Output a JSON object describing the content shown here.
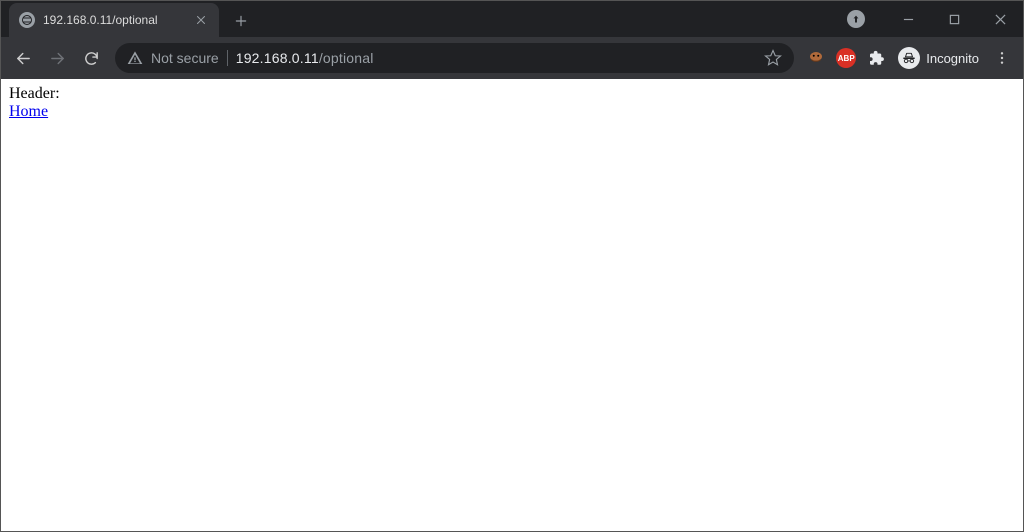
{
  "tab": {
    "title": "192.168.0.11/optional"
  },
  "toolbar": {
    "not_secure_label": "Not secure",
    "url_host": "192.168.0.11",
    "url_path": "/optional",
    "incognito_label": "Incognito",
    "abp_label": "ABP"
  },
  "page": {
    "header_label": "Header:",
    "home_link_label": "Home"
  }
}
